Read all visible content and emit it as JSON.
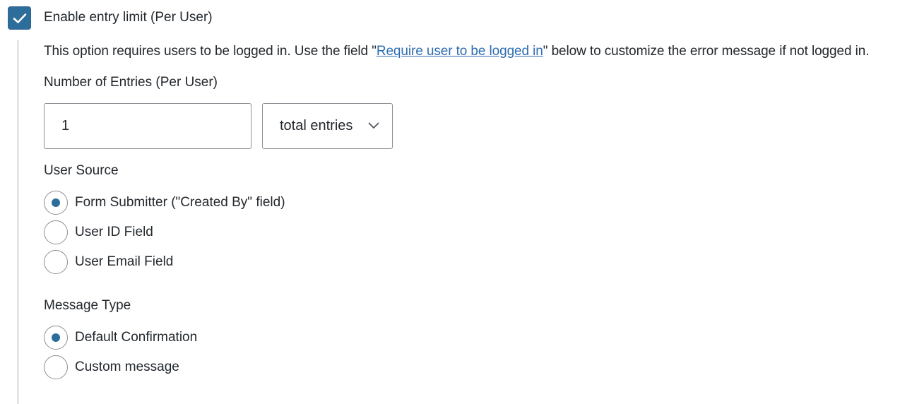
{
  "entry_limit": {
    "enabled": true,
    "checkbox_label": "Enable entry limit (Per User)",
    "notice": {
      "text_before": "This option requires users to be logged in. Use the field \"",
      "link_text": "Require user to be logged in",
      "text_after": "\" below to customize the error message if not logged in."
    },
    "number_of_entries": {
      "label": "Number of Entries (Per User)",
      "value": "1",
      "period_select": {
        "selected": "total entries"
      }
    },
    "user_source": {
      "label": "User Source",
      "options": [
        {
          "label": "Form Submitter (\"Created By\" field)",
          "selected": true
        },
        {
          "label": "User ID Field",
          "selected": false
        },
        {
          "label": "User Email Field",
          "selected": false
        }
      ]
    },
    "message_type": {
      "label": "Message Type",
      "options": [
        {
          "label": "Default Confirmation",
          "selected": true
        },
        {
          "label": "Custom message",
          "selected": false
        }
      ]
    }
  },
  "colors": {
    "accent": "#2d6d9b",
    "link": "#2f6db1",
    "text": "#23282d",
    "border": "#8c8f94",
    "indent_bar": "#e4e6e8"
  },
  "icons": {
    "checkbox": "checkmark-icon",
    "select": "chevron-down-icon"
  }
}
